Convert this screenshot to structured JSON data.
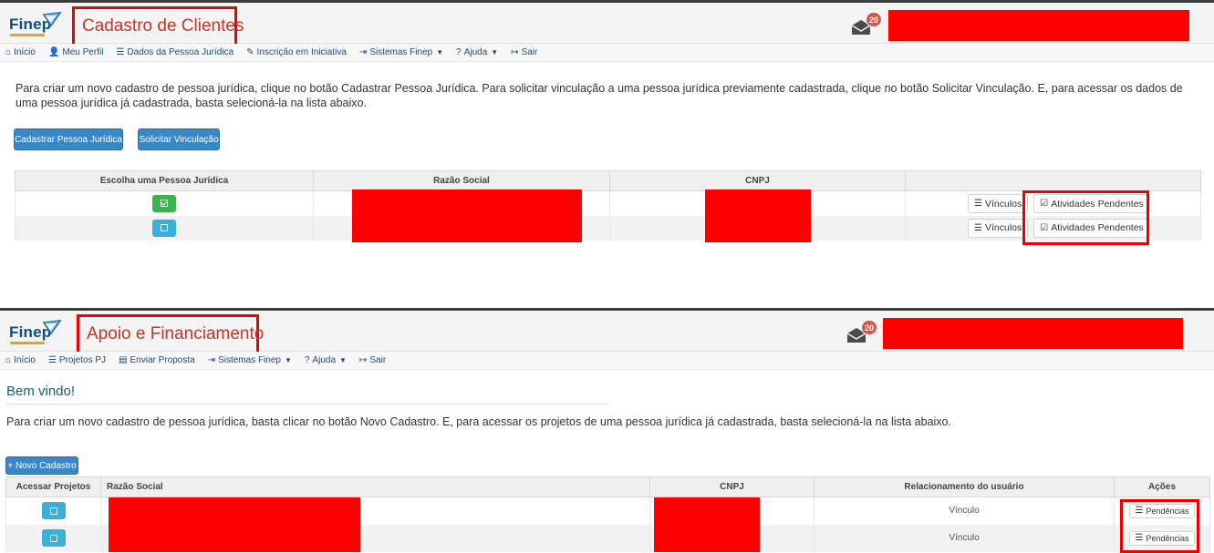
{
  "panel1": {
    "logo_text": "Finep",
    "title": "Cadastro de Clientes",
    "notification_count": "20",
    "menu": [
      {
        "icon": "home-icon",
        "glyph": "⌂",
        "label": "Início",
        "caret": false
      },
      {
        "icon": "user-icon",
        "glyph": "👤",
        "label": "Meu Perfil",
        "caret": false
      },
      {
        "icon": "list-icon",
        "glyph": "☰",
        "label": "Dados da Pessoa Jurídica",
        "caret": false
      },
      {
        "icon": "pencil-icon",
        "glyph": "✎",
        "label": "Inscrição em Iniciativa",
        "caret": false
      },
      {
        "icon": "sign-in-icon",
        "glyph": "⇥",
        "label": "Sistemas Finep",
        "caret": true
      },
      {
        "icon": "question-icon",
        "glyph": "?",
        "label": "Ajuda",
        "caret": true
      },
      {
        "icon": "sign-out-icon",
        "glyph": "↦",
        "label": "Sair",
        "caret": false
      }
    ],
    "paragraph": "Para criar um novo cadastro de pessoa jurídica, clique no botão Cadastrar Pessoa Jurídica. Para solicitar vinculação a uma pessoa jurídica previamente cadastrada, clique no botão Solicitar Vinculação. E, para acessar os dados de uma pessoa jurídica já cadastrada, basta selecioná-la na lista abaixo.",
    "btn_cadastrar": "Cadastrar Pessoa Jurídica",
    "btn_solicitar": "Solicitar Vinculação",
    "table": {
      "headers": [
        "Escolha uma Pessoa Jurídica",
        "Razão Social",
        "CNPJ",
        ""
      ],
      "rows": [
        {
          "vinculos": "Vínculos",
          "atividades": "Atividades Pendentes"
        },
        {
          "vinculos": "Vínculos",
          "atividades": "Atividades Pendentes"
        }
      ]
    }
  },
  "panel2": {
    "logo_text": "Finep",
    "title": "Apoio e Financiamento",
    "notification_count": "20",
    "menu": [
      {
        "icon": "home-icon",
        "glyph": "⌂",
        "label": "Início",
        "caret": false
      },
      {
        "icon": "list-icon",
        "glyph": "☰",
        "label": "Projetos PJ",
        "caret": false
      },
      {
        "icon": "document-icon",
        "glyph": "▤",
        "label": "Enviar Proposta",
        "caret": false
      },
      {
        "icon": "sign-in-icon",
        "glyph": "⇥",
        "label": "Sistemas Finep",
        "caret": true
      },
      {
        "icon": "question-icon",
        "glyph": "?",
        "label": "Ajuda",
        "caret": true
      },
      {
        "icon": "sign-out-icon",
        "glyph": "↦",
        "label": "Sair",
        "caret": false
      }
    ],
    "welcome": "Bem vindo!",
    "paragraph": "Para criar um novo cadastro de pessoa jurídica, basta clicar no botão Novo Cadastro. E, para acessar os projetos de uma pessoa jurídica já cadastrada, basta selecioná-la na lista abaixo.",
    "btn_novo": "+ Novo Cadastro",
    "table": {
      "headers": [
        "Acessar Projetos",
        "Razão Social",
        "CNPJ",
        "Relacionamento do usuário",
        "Ações"
      ],
      "rows": [
        {
          "relacionamento": "Vínculo",
          "acao": "Pendências"
        },
        {
          "relacionamento": "Vínculo",
          "acao": "Pendências"
        }
      ]
    }
  },
  "colors": {
    "highlight": "#ee0000",
    "redaction": "#ff0000",
    "primary_button": "#3a87c8",
    "select_green": "#3fb050",
    "select_cyan": "#38b0d8",
    "badge": "#d9534f",
    "title_text": "#c0392b",
    "logo": "#0b4f8a"
  }
}
